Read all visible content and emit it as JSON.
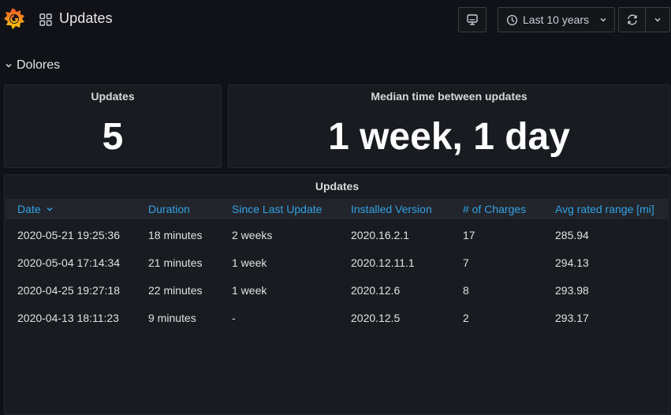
{
  "header": {
    "title": "Updates",
    "time_range": "Last 10 years"
  },
  "row": {
    "title": "Dolores"
  },
  "panels": {
    "updates_stat": {
      "title": "Updates",
      "value": "5"
    },
    "median_stat": {
      "title": "Median time between updates",
      "value": "1 week, 1 day"
    },
    "table": {
      "title": "Updates",
      "columns": [
        "Date",
        "Duration",
        "Since Last Update",
        "Installed Version",
        "# of Charges",
        "Avg rated range [mi]"
      ],
      "rows": [
        [
          "2020-05-21 19:25:36",
          "18 minutes",
          "2 weeks",
          "2020.16.2.1",
          "17",
          "285.94"
        ],
        [
          "2020-05-04 17:14:34",
          "21 minutes",
          "1 week",
          "2020.12.11.1",
          "7",
          "294.13"
        ],
        [
          "2020-04-25 19:27:18",
          "22 minutes",
          "1 week",
          "2020.12.6",
          "8",
          "293.98"
        ],
        [
          "2020-04-13 18:11:23",
          "9 minutes",
          "-",
          "2020.12.5",
          "2",
          "293.17"
        ]
      ]
    }
  },
  "icons": {
    "logo": "grafana-logo",
    "apps": "apps-grid-icon",
    "tv": "tv-monitor-icon",
    "clock": "clock-icon",
    "refresh": "refresh-icon",
    "dropdown": "chevron-down-icon",
    "sort": "sort-desc-icon"
  },
  "colors": {
    "background": "#111217",
    "panel": "#181b1f",
    "header_link": "#33a2e5",
    "logo_orange": "#f05a28",
    "logo_yellow": "#fbca0a"
  }
}
